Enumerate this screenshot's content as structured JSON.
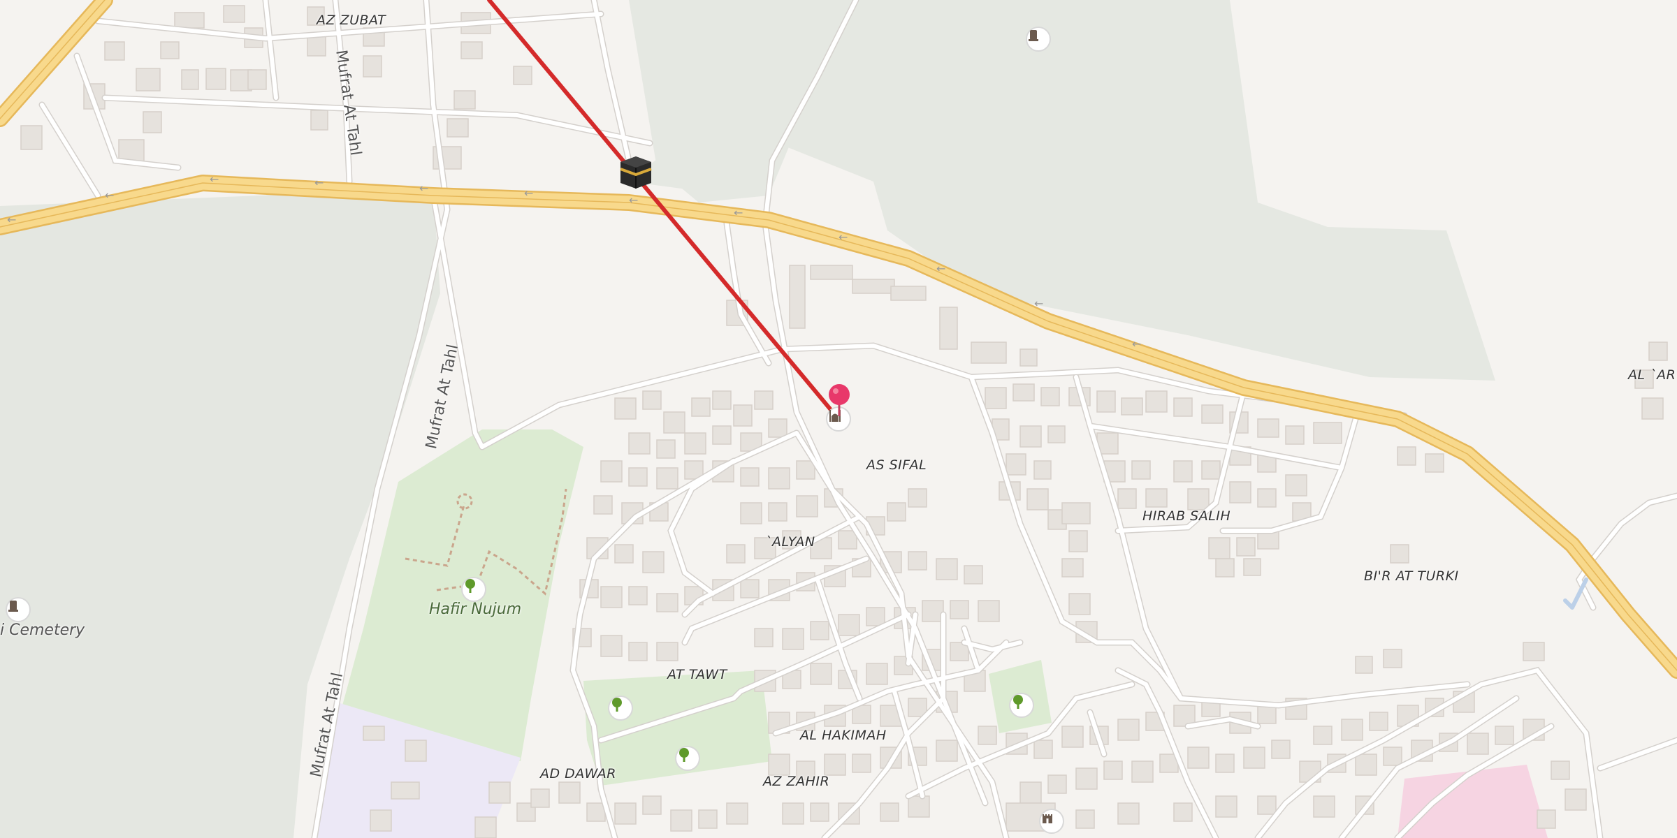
{
  "map": {
    "neighborhoods": [
      {
        "name": "AZ ZUBAT"
      },
      {
        "name": "AS SIFAL"
      },
      {
        "name": "`ALYAN"
      },
      {
        "name": "HIRAB SALIH"
      },
      {
        "name": "BI'R AT TURKI"
      },
      {
        "name": "AT TAWT"
      },
      {
        "name": "AL HAKIMAH"
      },
      {
        "name": "AD DAWAR"
      },
      {
        "name": "AZ ZAHIR"
      },
      {
        "name": "AL `AR"
      }
    ],
    "streets": [
      {
        "name": "Mufrat At Tahl"
      },
      {
        "name": "Mufrat At Tahl"
      },
      {
        "name": "Mufrat At Tahl"
      }
    ],
    "places": [
      {
        "name": "Hafir Nujum",
        "type": "park"
      },
      {
        "name": "i Cemetery",
        "type": "cemetery"
      }
    ],
    "icons": [
      "kaaba-icon",
      "pin-marker-icon",
      "mosque-icon",
      "tree-icon",
      "cemetery-icon",
      "castle-icon"
    ],
    "colors": {
      "background": "#f5f3f0",
      "forest": "#e5e8e2",
      "park": "#dcebd2",
      "highway": "#f8d98c",
      "highway_casing": "#e6b85a",
      "direction_line": "#d42a2a",
      "marker": "#e8386a"
    }
  }
}
